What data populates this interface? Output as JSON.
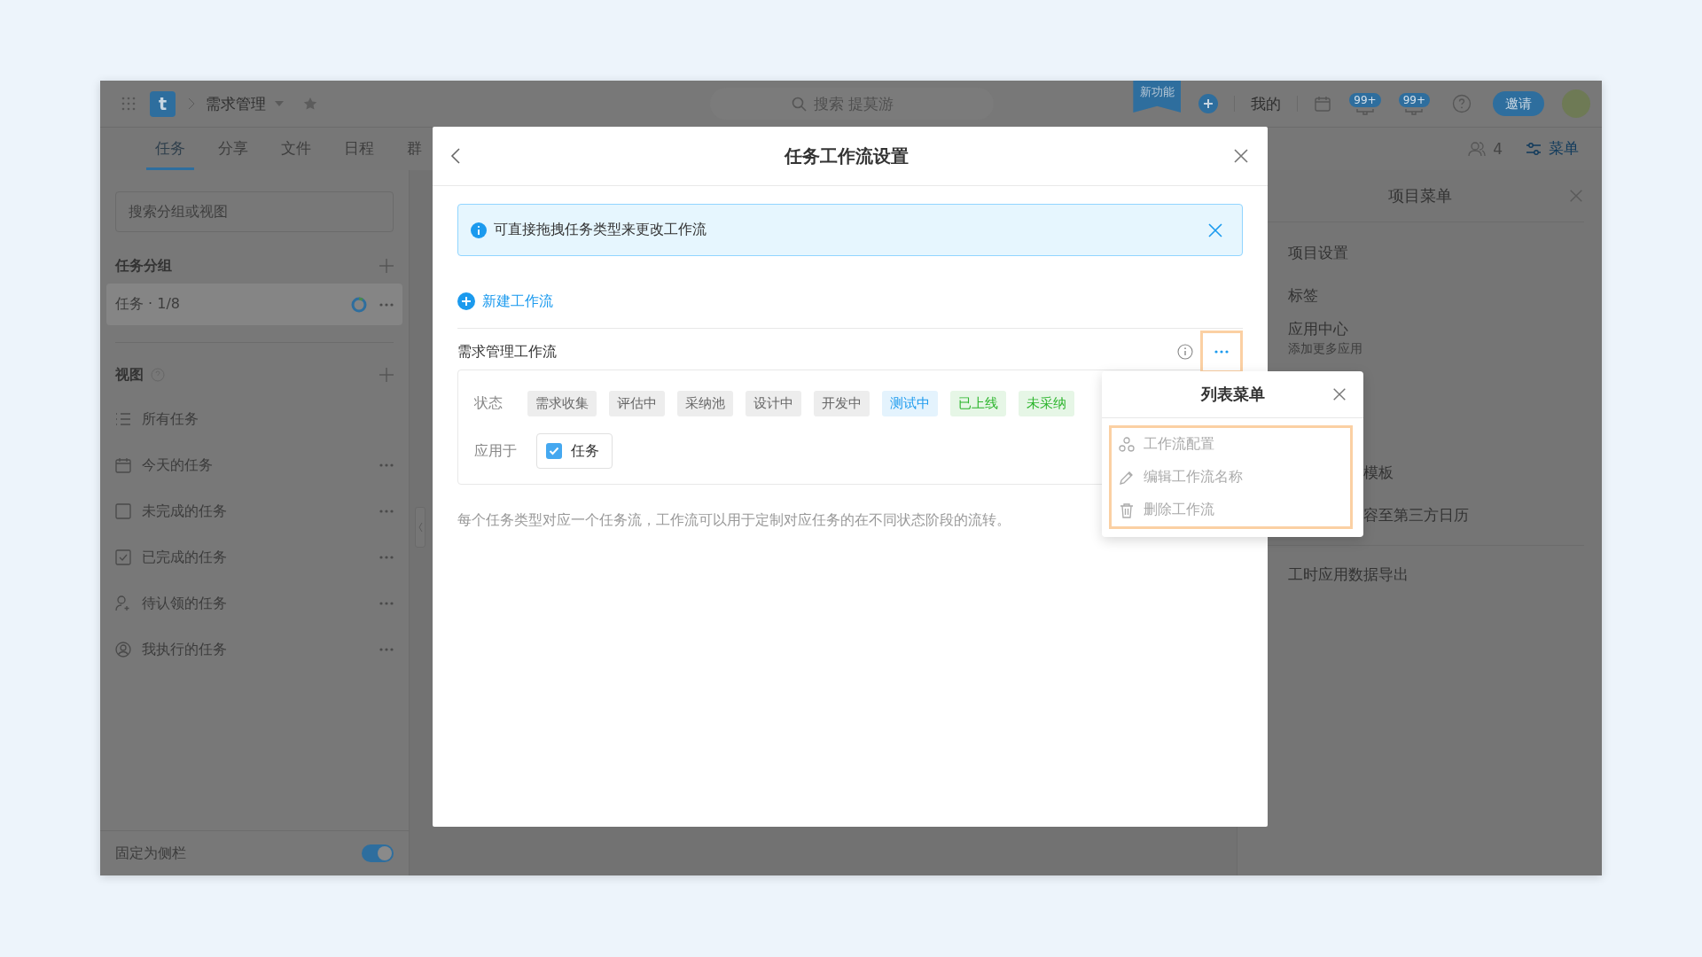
{
  "topbar": {
    "logo_letter": "t",
    "project": "需求管理",
    "search_placeholder": "搜索 提莫游",
    "new_feature_badge": "新功能",
    "mine": "我的",
    "notifications": [
      {
        "count": "99+"
      },
      {
        "count": "99+"
      }
    ],
    "invite_button": "邀请"
  },
  "tabs": [
    {
      "label": "任务",
      "selected": true
    },
    {
      "label": "分享",
      "selected": false
    },
    {
      "label": "文件",
      "selected": false
    },
    {
      "label": "日程",
      "selected": false
    },
    {
      "label": "群",
      "selected": false
    }
  ],
  "tab_actions": {
    "member_count": "4",
    "menu": "菜单"
  },
  "sidebar": {
    "search_placeholder": "搜索分组或视图",
    "groups_title": "任务分组",
    "groups": [
      {
        "label": "任务 · 1/8",
        "selected": true
      }
    ],
    "views_title": "视图",
    "views": [
      {
        "label": "所有任务",
        "kind": "list",
        "more_button": false
      },
      {
        "label": "今天的任务",
        "kind": "calendar",
        "more_button": true
      },
      {
        "label": "未完成的任务",
        "kind": "unchecked",
        "more_button": true
      },
      {
        "label": "已完成的任务",
        "kind": "checked",
        "more_button": true
      },
      {
        "label": "待认领的任务",
        "kind": "person-add",
        "more_button": true
      },
      {
        "label": "我执行的任务",
        "kind": "person-circle",
        "more_button": true
      }
    ],
    "pin": {
      "label": "固定为侧栏",
      "on": true
    }
  },
  "project_menu": {
    "title": "项目菜单",
    "items": [
      {
        "label": "项目设置",
        "kind": "full"
      },
      {
        "label": "标签",
        "kind": "full"
      },
      {
        "label": "应用中心",
        "kind": "full",
        "subtitle": "添加更多应用"
      },
      {
        "label": "模板",
        "kind": "covered"
      },
      {
        "label": "容至第三方日历",
        "kind": "covered"
      },
      {
        "label": "工时应用数据导出",
        "kind": "full"
      }
    ]
  },
  "dialog": {
    "title": "任务工作流设置",
    "notice": "可直接拖拽任务类型来更改工作流",
    "new_workflow": "新建工作流",
    "workflows": [
      {
        "name": "需求管理工作流",
        "more_highlighted": true,
        "status_label": "状态",
        "statuses": [
          {
            "label": "需求收集",
            "color": "#666666"
          },
          {
            "label": "评估中",
            "color": "#666666"
          },
          {
            "label": "采纳池",
            "color": "#666666"
          },
          {
            "label": "设计中",
            "color": "#666666"
          },
          {
            "label": "开发中",
            "color": "#666666"
          },
          {
            "label": "测试中",
            "color": "#1b9aee"
          },
          {
            "label": "已上线",
            "color": "#2db52d"
          },
          {
            "label": "未采纳",
            "color": "#2db52d"
          }
        ],
        "apply_label": "应用于",
        "targets": [
          {
            "label": "任务",
            "checked": true
          }
        ]
      }
    ],
    "description": "每个任务类型对应一个任务流，工作流可以用于定制对应任务的在不同状态阶段的流转。"
  },
  "list_menu": {
    "title": "列表菜单",
    "highlighted": true,
    "items": [
      {
        "label": "工作流配置",
        "kind": "config"
      },
      {
        "label": "编辑工作流名称",
        "kind": "edit"
      },
      {
        "label": "删除工作流",
        "kind": "delete"
      }
    ]
  }
}
